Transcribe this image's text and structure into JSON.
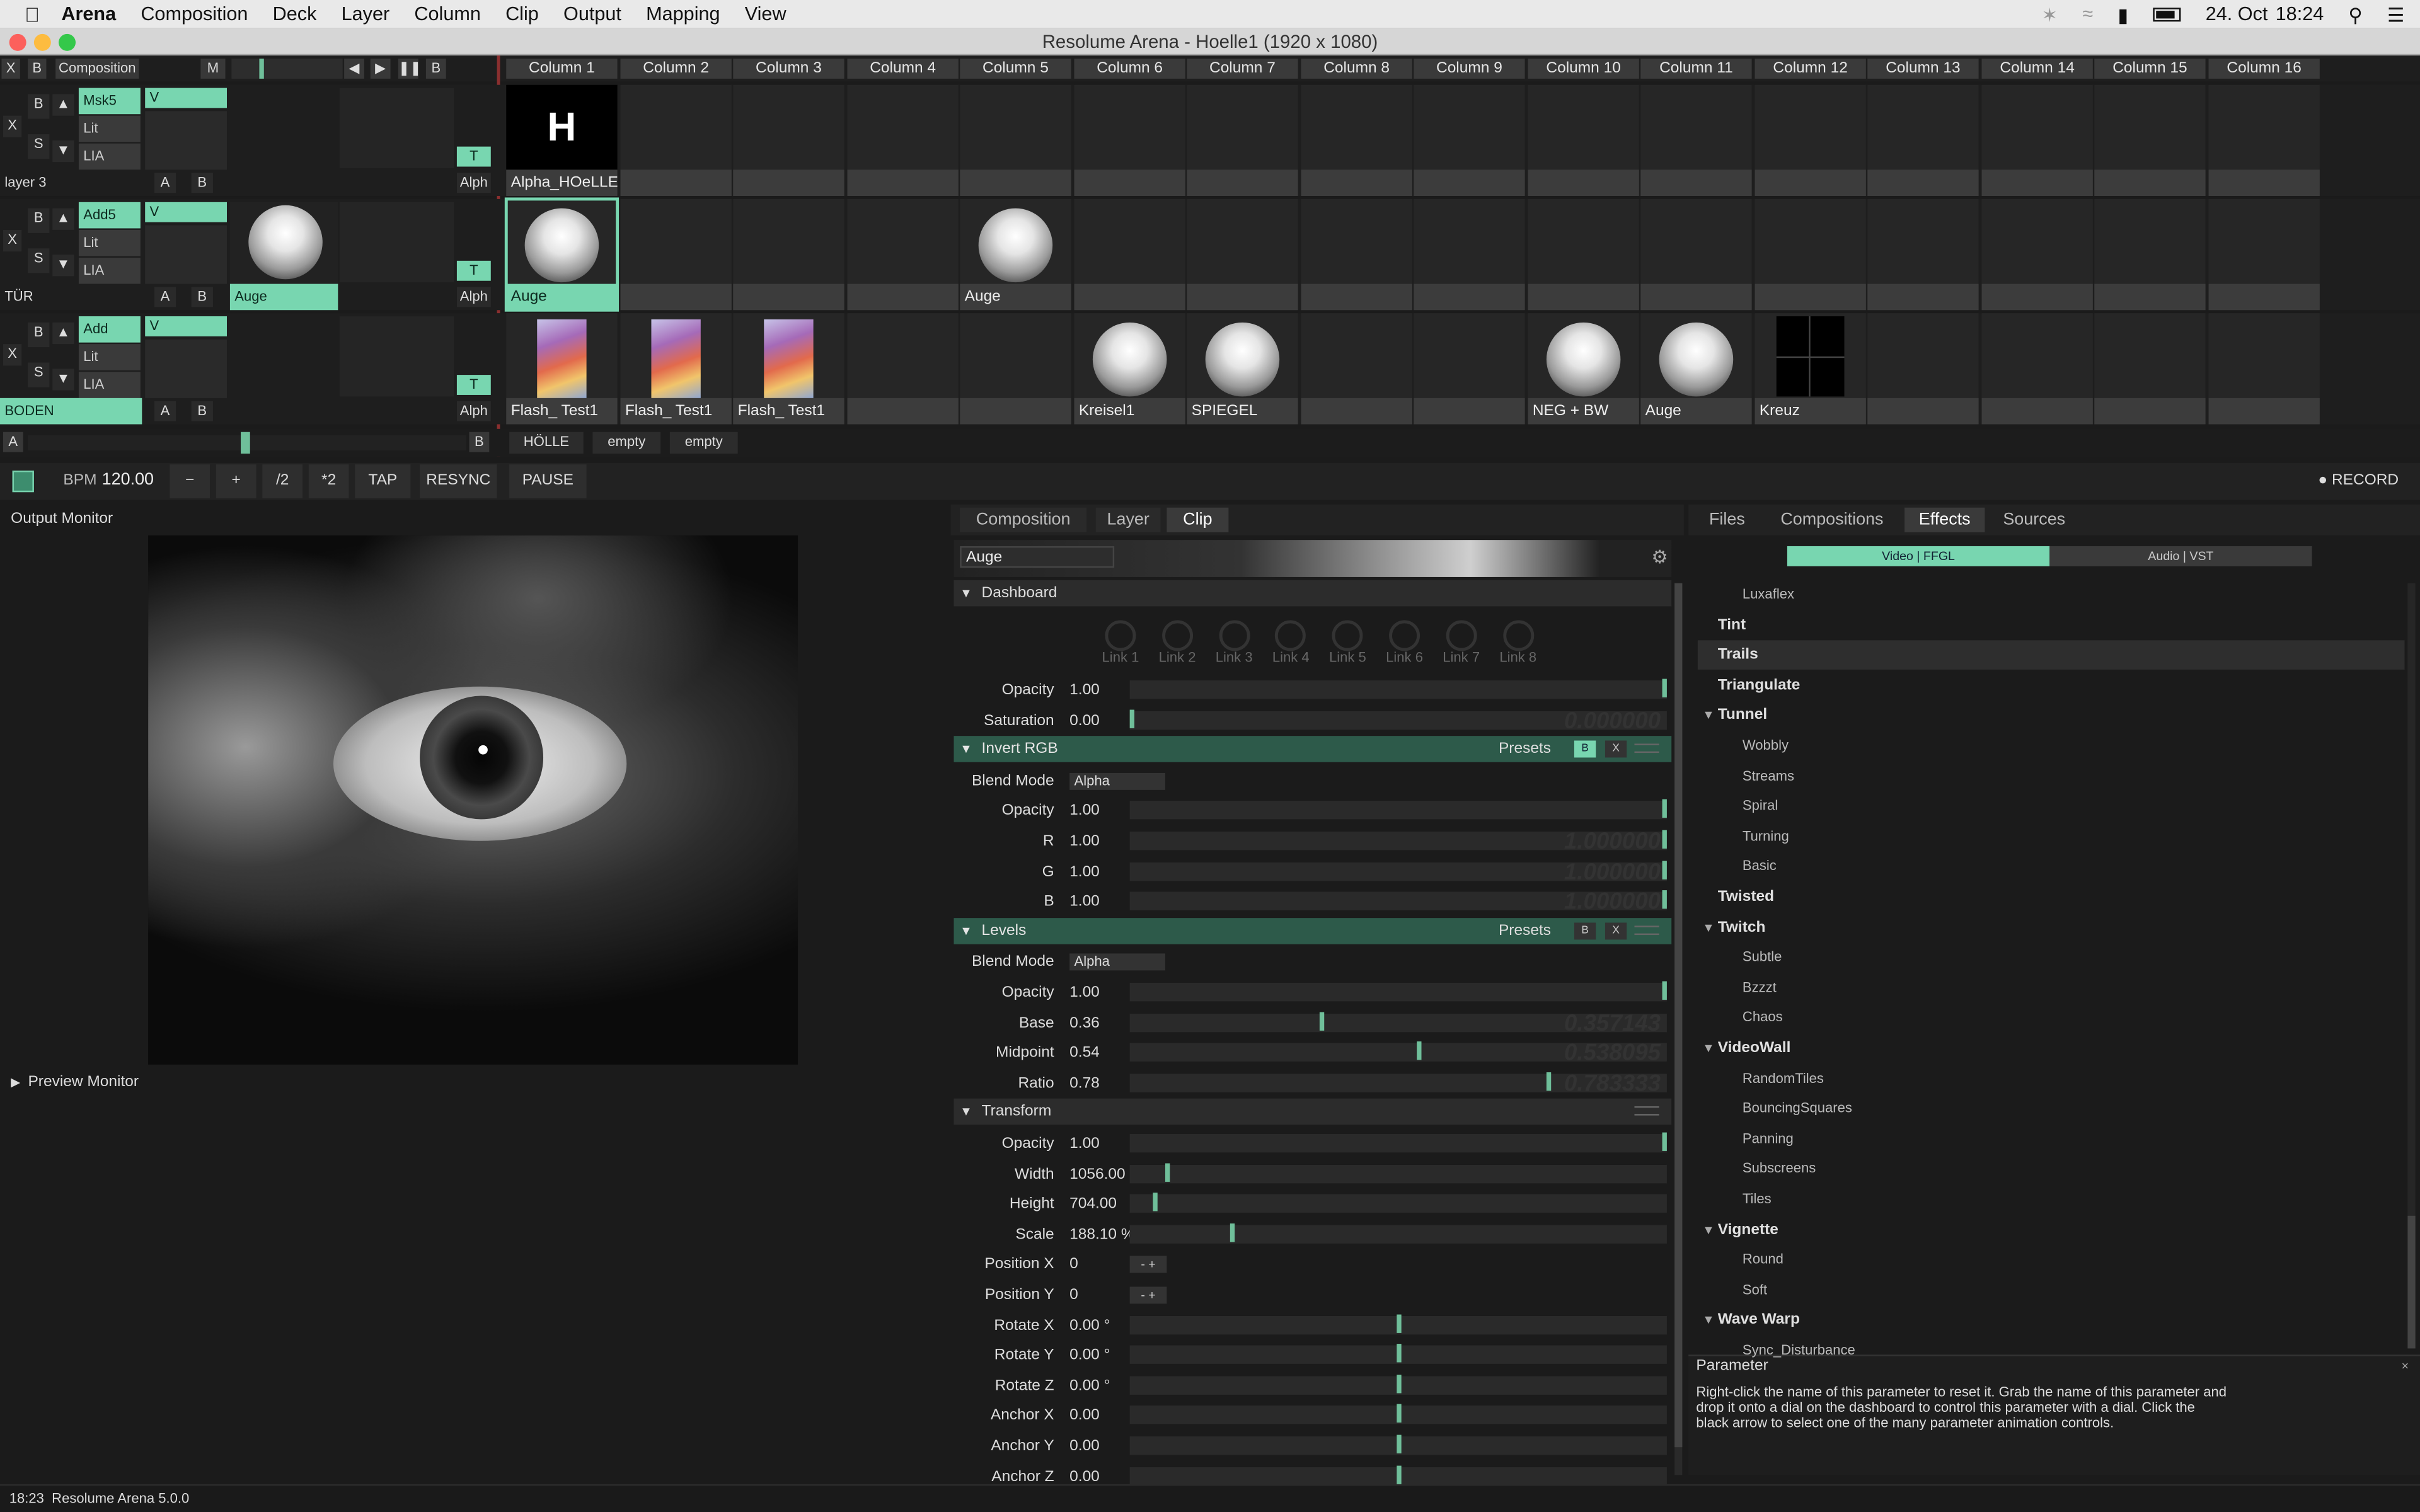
{
  "menubar": {
    "app": "Arena",
    "items": [
      "Composition",
      "Deck",
      "Layer",
      "Column",
      "Clip",
      "Output",
      "Mapping",
      "View"
    ],
    "battery_icon": "battery-icon",
    "date": "24. Oct",
    "time": "18:24"
  },
  "window": {
    "title": "Resolume Arena - Hoelle1 (1920 x 1080)"
  },
  "composition": {
    "x": "X",
    "b": "B",
    "name": "Composition",
    "m": "M",
    "columns": [
      "Column 1",
      "Column 2",
      "Column 3",
      "Column 4",
      "Column 5",
      "Column 6",
      "Column 7",
      "Column 8",
      "Column 9",
      "Column 10",
      "Column 11",
      "Column 12",
      "Column 13",
      "Column 14",
      "Column 15",
      "Column 16"
    ]
  },
  "layers": [
    {
      "name": "layer 3",
      "blend": "Msk5",
      "v": "V",
      "lit": "Lit",
      "lia": "LIA",
      "a": "A",
      "b": "B",
      "t": "T",
      "alph": "Alph",
      "bs": "B",
      "s": "S",
      "x": "X",
      "clips": [
        {
          "col": 0,
          "kind": "text",
          "glyph": "H",
          "label": "Alpha_HOeLLE"
        }
      ]
    },
    {
      "name": "TÜR",
      "blend": "Add5",
      "v": "V",
      "lit": "Lit",
      "lia": "LIA",
      "a": "A",
      "b": "B",
      "t": "T",
      "alph": "Alph",
      "bs": "B",
      "s": "S",
      "x": "X",
      "preview_label": "Auge",
      "clips": [
        {
          "col": 0,
          "kind": "ball",
          "label": "Auge",
          "selected": true
        },
        {
          "col": 4,
          "kind": "ball",
          "label": "Auge"
        }
      ]
    },
    {
      "name": "BODEN",
      "blend": "Add",
      "v": "V",
      "lit": "Lit",
      "lia": "LIA",
      "a": "A",
      "b": "B",
      "t": "T",
      "alph": "Alph",
      "bs": "B",
      "s": "S",
      "x": "X",
      "clips": [
        {
          "col": 0,
          "kind": "thumb",
          "label": "Flash_ Test1"
        },
        {
          "col": 1,
          "kind": "thumb",
          "label": "Flash_ Test1"
        },
        {
          "col": 2,
          "kind": "thumb",
          "label": "Flash_ Test1"
        },
        {
          "col": 5,
          "kind": "ball",
          "label": "Kreisel1"
        },
        {
          "col": 6,
          "kind": "ball",
          "label": "SPIEGEL"
        },
        {
          "col": 9,
          "kind": "ball",
          "label": "NEG + BW"
        },
        {
          "col": 10,
          "kind": "ball",
          "label": "Auge"
        },
        {
          "col": 11,
          "kind": "cross",
          "label": "Kreuz"
        }
      ]
    }
  ],
  "deck": {
    "a": "A",
    "b": "B",
    "tabs": [
      "HÖLLE",
      "empty",
      "empty"
    ]
  },
  "transport": {
    "bpm_label": "BPM",
    "bpm": "120.00",
    "minus": "−",
    "plus": "+",
    "half": "/2",
    "double": "*2",
    "tap": "TAP",
    "resync": "RESYNC",
    "pause": "PAUSE",
    "record": "RECORD"
  },
  "output": {
    "title": "Output Monitor",
    "preview": "Preview Monitor"
  },
  "clip_panel": {
    "tabs": [
      "Composition",
      "Layer",
      "Clip"
    ],
    "active_tab": "Clip",
    "clip_name": "Auge",
    "dashboard": {
      "title": "Dashboard",
      "links": [
        "Link 1",
        "Link 2",
        "Link 3",
        "Link 4",
        "Link 5",
        "Link 6",
        "Link 7",
        "Link 8"
      ]
    },
    "opacity": {
      "label": "Opacity",
      "value": "1.00",
      "level": 1.0
    },
    "saturation": {
      "label": "Saturation",
      "value": "0.00",
      "level": 0.0,
      "ghost": "0.000000"
    },
    "invert_rgb": {
      "title": "Invert RGB",
      "presets": "Presets",
      "b": "B",
      "x": "X",
      "blend_label": "Blend Mode",
      "blend": "Alpha",
      "params": [
        {
          "label": "Opacity",
          "value": "1.00",
          "level": 1.0
        },
        {
          "label": "R",
          "value": "1.00",
          "level": 1.0,
          "ghost": "1.000000"
        },
        {
          "label": "G",
          "value": "1.00",
          "level": 1.0,
          "ghost": "1.000000"
        },
        {
          "label": "B",
          "value": "1.00",
          "level": 1.0,
          "ghost": "1.000000"
        }
      ]
    },
    "levels": {
      "title": "Levels",
      "presets": "Presets",
      "b": "B",
      "x": "X",
      "blend_label": "Blend Mode",
      "blend": "Alpha",
      "params": [
        {
          "label": "Opacity",
          "value": "1.00",
          "level": 1.0
        },
        {
          "label": "Base",
          "value": "0.36",
          "level": 0.357,
          "ghost": "0.357143"
        },
        {
          "label": "Midpoint",
          "value": "0.54",
          "level": 0.538,
          "ghost": "0.538095"
        },
        {
          "label": "Ratio",
          "value": "0.78",
          "level": 0.783,
          "ghost": "0.783333"
        }
      ]
    },
    "transform": {
      "title": "Transform",
      "params": [
        {
          "label": "Opacity",
          "value": "1.00",
          "level": 1.0
        },
        {
          "label": "Width",
          "value": "1056.00",
          "level": 0.066
        },
        {
          "label": "Height",
          "value": "704.00",
          "level": 0.044
        },
        {
          "label": "Scale",
          "value": "188.10 %",
          "level": 0.188
        },
        {
          "label": "Position X",
          "value": "0",
          "stepper": true
        },
        {
          "label": "Position Y",
          "value": "0",
          "stepper": true
        },
        {
          "label": "Rotate X",
          "value": "0.00 °",
          "level": 0.5
        },
        {
          "label": "Rotate Y",
          "value": "0.00 °",
          "level": 0.5
        },
        {
          "label": "Rotate Z",
          "value": "0.00 °",
          "level": 0.5
        },
        {
          "label": "Anchor X",
          "value": "0.00",
          "level": 0.5
        },
        {
          "label": "Anchor Y",
          "value": "0.00",
          "level": 0.5
        },
        {
          "label": "Anchor Z",
          "value": "0.00",
          "level": 0.5
        }
      ]
    }
  },
  "browser": {
    "tabs": [
      "Files",
      "Compositions",
      "Effects",
      "Sources"
    ],
    "active": "Effects",
    "filters": [
      "Video | FFGL",
      "Audio | VST"
    ],
    "items": [
      {
        "t": "sub",
        "n": "Luxaflex"
      },
      {
        "t": "top",
        "n": "Tint"
      },
      {
        "t": "top",
        "n": "Trails",
        "sel": true
      },
      {
        "t": "top",
        "n": "Triangulate"
      },
      {
        "t": "fold",
        "n": "Tunnel"
      },
      {
        "t": "sub",
        "n": "Wobbly"
      },
      {
        "t": "sub",
        "n": "Streams"
      },
      {
        "t": "sub",
        "n": "Spiral"
      },
      {
        "t": "sub",
        "n": "Turning"
      },
      {
        "t": "sub",
        "n": "Basic"
      },
      {
        "t": "top",
        "n": "Twisted"
      },
      {
        "t": "fold",
        "n": "Twitch"
      },
      {
        "t": "sub",
        "n": "Subtle"
      },
      {
        "t": "sub",
        "n": "Bzzzt"
      },
      {
        "t": "sub",
        "n": "Chaos"
      },
      {
        "t": "fold",
        "n": "VideoWall"
      },
      {
        "t": "sub",
        "n": "RandomTiles"
      },
      {
        "t": "sub",
        "n": "BouncingSquares"
      },
      {
        "t": "sub",
        "n": "Panning"
      },
      {
        "t": "sub",
        "n": "Subscreens"
      },
      {
        "t": "sub",
        "n": "Tiles"
      },
      {
        "t": "fold",
        "n": "Vignette"
      },
      {
        "t": "sub",
        "n": "Round"
      },
      {
        "t": "sub",
        "n": "Soft"
      },
      {
        "t": "fold",
        "n": "Wave Warp"
      },
      {
        "t": "sub",
        "n": "Sync_Disturbance"
      }
    ]
  },
  "parameter_help": {
    "title": "Parameter",
    "text": "Right-click the name of this parameter to reset it. Grab the name of this parameter and drop it onto a dial on the dashboard to control this parameter with a dial. Click the black arrow to select one of the many parameter animation controls."
  },
  "statusbar": {
    "time": "18:23",
    "version": "Resolume Arena 5.0.0"
  }
}
